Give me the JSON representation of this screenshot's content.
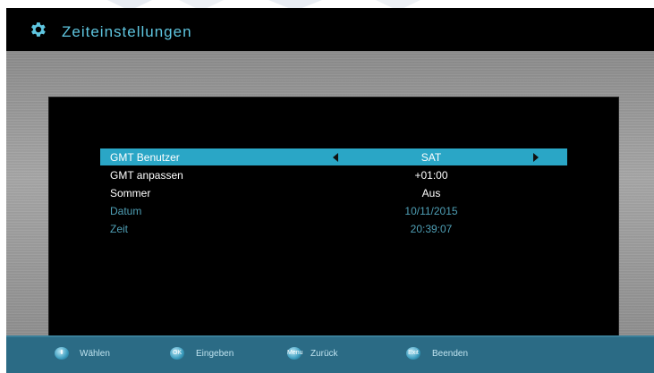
{
  "header": {
    "title": "Zeiteinstellungen",
    "icon": "gear-icon"
  },
  "settings": {
    "rows": [
      {
        "label": "GMT Benutzer",
        "value": "SAT"
      },
      {
        "label": "GMT anpassen",
        "value": "+01:00"
      },
      {
        "label": "Sommer",
        "value": "Aus"
      },
      {
        "label": "Datum",
        "value": "10/11/2015"
      },
      {
        "label": "Zeit",
        "value": "20:39:07"
      }
    ]
  },
  "footer": {
    "hints": [
      {
        "icon": "up-down-icon",
        "icon_text": "",
        "label": "Wählen"
      },
      {
        "icon": "ok-icon",
        "icon_text": "OK",
        "label": "Eingeben"
      },
      {
        "icon": "menu-icon",
        "icon_text": "Menu",
        "label": "Zurück"
      },
      {
        "icon": "exit-icon",
        "icon_text": "Exit",
        "label": "Beenden"
      }
    ]
  },
  "colors": {
    "title": "#5fc6e0",
    "selected_row": "#2aa6c6",
    "footer": "#2b6b85",
    "dim_text": "#4f9fb5"
  }
}
